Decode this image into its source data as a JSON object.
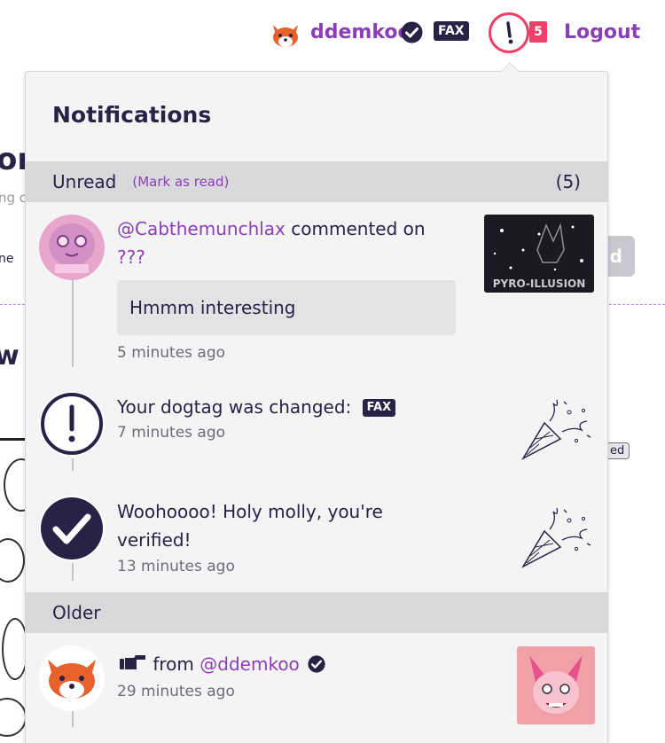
{
  "background": {
    "title_fragment": "or",
    "subtitle_fragment": "ng c",
    "small_fragment": "ne",
    "title2_fragment": "w",
    "button_fragment": "d",
    "tag_fragment": "ed"
  },
  "nav": {
    "username": "ddemkoo",
    "dogtag": "FAX",
    "notification_count": "5",
    "logout_label": "Logout"
  },
  "notifications": {
    "title": "Notifications",
    "unread": {
      "label": "Unread",
      "mark_as_read": "(Mark as read)",
      "count": "(5)"
    },
    "older_label": "Older",
    "items": [
      {
        "user": "@Cabthemunchlax",
        "action": " commented on",
        "target": "???",
        "comment": "Hmmm interesting",
        "time": "5 minutes ago",
        "thumb_caption": "PYRO-ILLUSION"
      },
      {
        "text": "Your dogtag was changed:",
        "badge": "FAX",
        "time": "7 minutes ago"
      },
      {
        "text": "Woohoooo! Holy molly, you're verified!",
        "time": "13 minutes ago"
      },
      {
        "from": " from ",
        "user": "@ddemkoo",
        "time": "29 minutes ago"
      }
    ]
  },
  "colors": {
    "accent": "#8b3fb6",
    "alert": "#ee3f68",
    "dark": "#2a2146",
    "section_bg": "#d9d9dc"
  }
}
